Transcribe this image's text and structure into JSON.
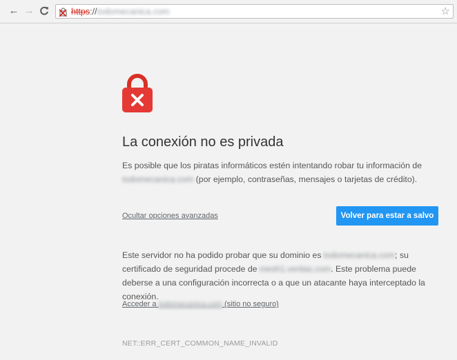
{
  "browser": {
    "url": {
      "scheme": "https",
      "separator": "://",
      "host": "todomecanica.com"
    }
  },
  "interstitial": {
    "title": "La conexión no es privada",
    "description": {
      "before": "Es posible que los piratas informáticos estén intentando robar tu información de ",
      "host": "todomecanica.com",
      "after": " (por ejemplo, contraseñas, mensajes o tarjetas de crédito)."
    },
    "advanced_link": "Ocultar opciones avanzadas",
    "back_button": "Volver para estar a salvo",
    "details": {
      "part1": "Este servidor no ha podido probar que su dominio es ",
      "domain": "todomecanica.com",
      "part2": "; su certificado de seguridad procede de ",
      "issuer": "mesh1.veritas.com",
      "part3": ". Este problema puede deberse a una configuración incorrecta o a que un atacante haya interceptado la conexión."
    },
    "proceed_link": {
      "prefix": "Acceder a ",
      "host": "todomecanica.com",
      "suffix": " (sitio no seguro)"
    },
    "error_code": "NET::ERR_CERT_COMMON_NAME_INVALID"
  },
  "colors": {
    "accent": "#2196f3",
    "danger": "#db4437",
    "background": "#f2f2f2"
  }
}
